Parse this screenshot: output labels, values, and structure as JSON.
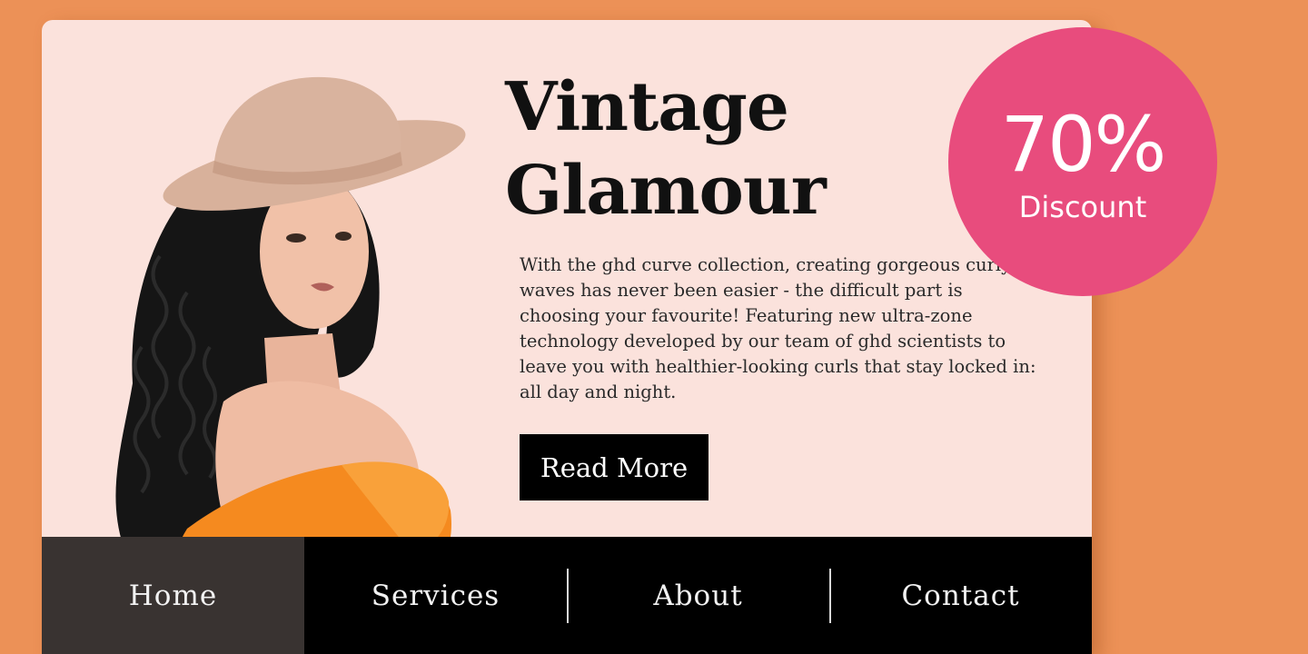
{
  "hero": {
    "title_line1": "Vintage",
    "title_line2": "Glamour",
    "description": "With the ghd curve collection, creating gorgeous curly waves has never been easier - the difficult part is choosing your favourite! Featuring new ultra-zone technology developed by our team of ghd scientists to leave you with healthier-looking curls that stay locked in: all day and night.",
    "button_label": "Read More"
  },
  "badge": {
    "percent": "70%",
    "label": "Discount"
  },
  "nav": {
    "items": [
      {
        "label": "Home"
      },
      {
        "label": "Services"
      },
      {
        "label": "About"
      },
      {
        "label": "Contact"
      }
    ],
    "active": "Home"
  },
  "colors": {
    "page_background": "#ec9157",
    "card_background": "#fbe2dc",
    "badge": "#e84c7d",
    "nav_background": "#000000",
    "button_background": "#000000"
  },
  "icons": [
    "model-photo"
  ]
}
